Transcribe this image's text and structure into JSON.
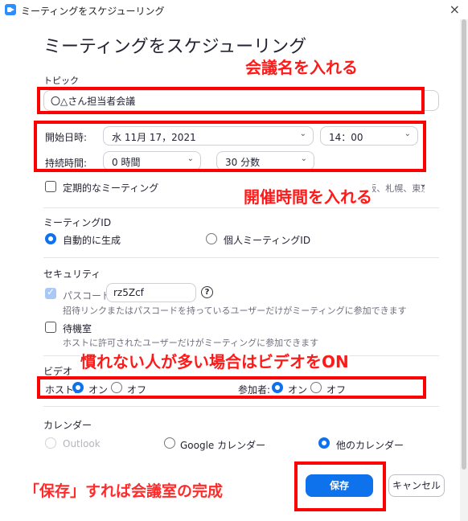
{
  "window": {
    "title": "ミーティングをスケジューリング",
    "close_glyph": "×"
  },
  "page_title": "ミーティングをスケジューリング",
  "topic": {
    "label": "トピック",
    "value": "〇△さん担当者会議"
  },
  "schedule": {
    "start_label": "開始日時:",
    "start_date": "水  11月  17，2021",
    "start_time": "14：00",
    "duration_label": "持続時間:",
    "duration_hours": "0 時間",
    "duration_minutes": "30 分数",
    "recurring_label": "定期的なミーティング",
    "timezone": "タイムゾーン：大阪、札幌、東京"
  },
  "meeting_id": {
    "heading": "ミーティングID",
    "auto_label": "自動的に生成",
    "personal_label": "個人ミーティングID"
  },
  "security": {
    "heading": "セキュリティ",
    "passcode_label": "パスコード",
    "passcode_value": "rz5Zcf",
    "passcode_help": "招待リンクまたはパスコードを持っているユーザーだけがミーティングに参加できます",
    "waiting_label": "待機室",
    "waiting_help": "ホストに許可されたユーザーだけがミーティングに参加できます",
    "help_glyph": "?"
  },
  "video": {
    "heading": "ビデオ",
    "host_label": "ホスト:",
    "host_on": "オン",
    "host_off": "オフ",
    "participant_label": "参加者:",
    "participant_on": "オン",
    "participant_off": "オフ"
  },
  "calendar": {
    "heading": "カレンダー",
    "outlook": "Outlook",
    "google": "Google カレンダー",
    "other": "他のカレンダー"
  },
  "buttons": {
    "save": "保存",
    "cancel": "キャンセル"
  },
  "annotations": {
    "topic_note": "会議名を入れる",
    "time_note": "開催時間を入れる",
    "video_note": "慣れない人が多い場合はビデオをON",
    "save_note": "「保存」すれば会議室の完成"
  },
  "colors": {
    "accent": "#0e72ed",
    "annotation": "#ff0000"
  }
}
